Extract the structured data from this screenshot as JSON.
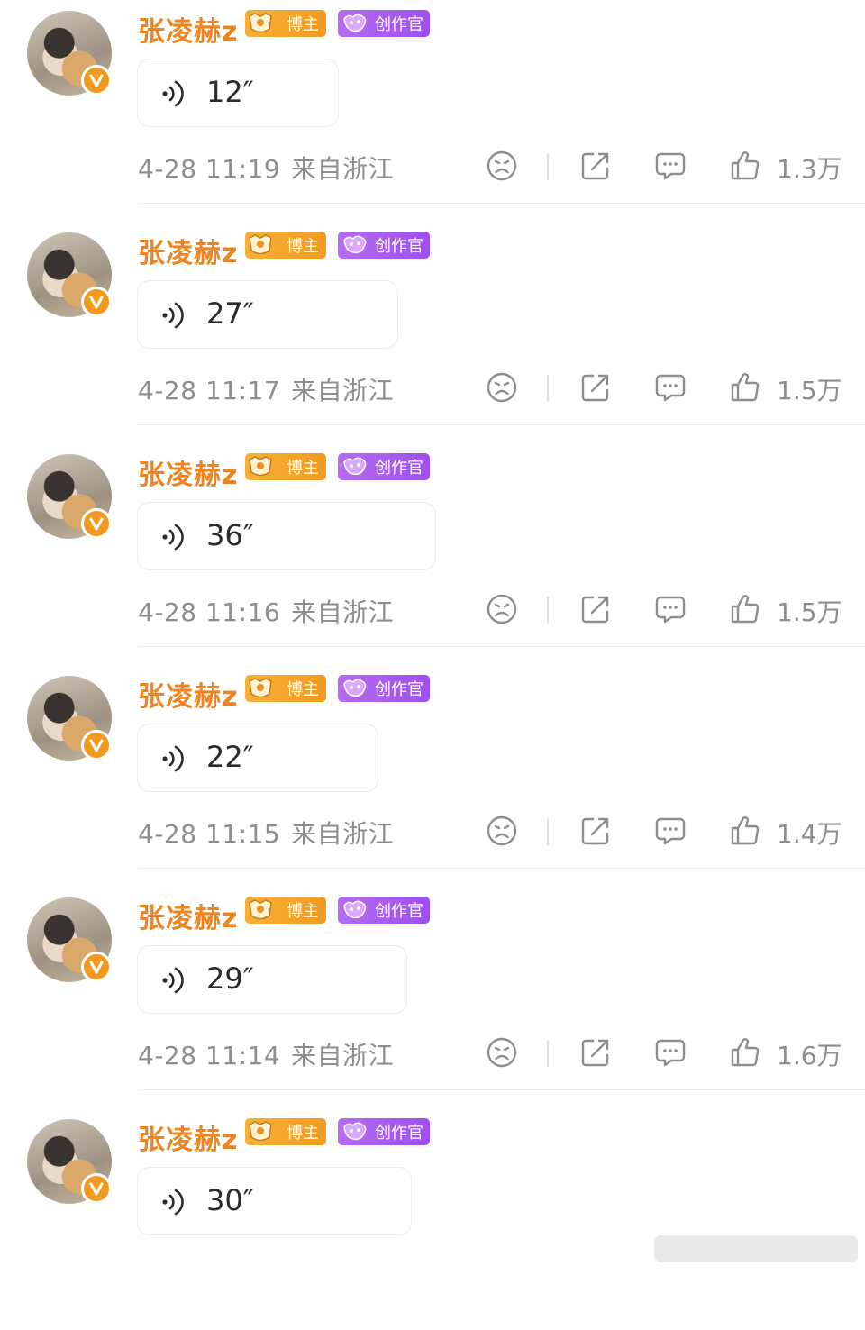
{
  "colors": {
    "accent_orange": "#f0831c",
    "blogger_badge": "#f39a20",
    "creator_badge": "#9d4ff0",
    "meta_gray": "#8e8e8e"
  },
  "badges": {
    "blogger": "博主",
    "creator": "创作官"
  },
  "icons": {
    "voice": "voice-wave-icon",
    "dislike": "sad-face-icon",
    "share": "share-icon",
    "comment": "comment-icon",
    "like": "thumbs-up-icon"
  },
  "posts": [
    {
      "username": "张凌赫z",
      "duration": "12″",
      "time": "4-28 11:19",
      "location": "来自浙江",
      "likes": "1.3万"
    },
    {
      "username": "张凌赫z",
      "duration": "27″",
      "time": "4-28 11:17",
      "location": "来自浙江",
      "likes": "1.5万"
    },
    {
      "username": "张凌赫z",
      "duration": "36″",
      "time": "4-28 11:16",
      "location": "来自浙江",
      "likes": "1.5万"
    },
    {
      "username": "张凌赫z",
      "duration": "22″",
      "time": "4-28 11:15",
      "location": "来自浙江",
      "likes": "1.4万"
    },
    {
      "username": "张凌赫z",
      "duration": "29″",
      "time": "4-28 11:14",
      "location": "来自浙江",
      "likes": "1.6万"
    },
    {
      "username": "张凌赫z",
      "duration": "30″",
      "time": "",
      "location": "",
      "likes": ""
    }
  ]
}
